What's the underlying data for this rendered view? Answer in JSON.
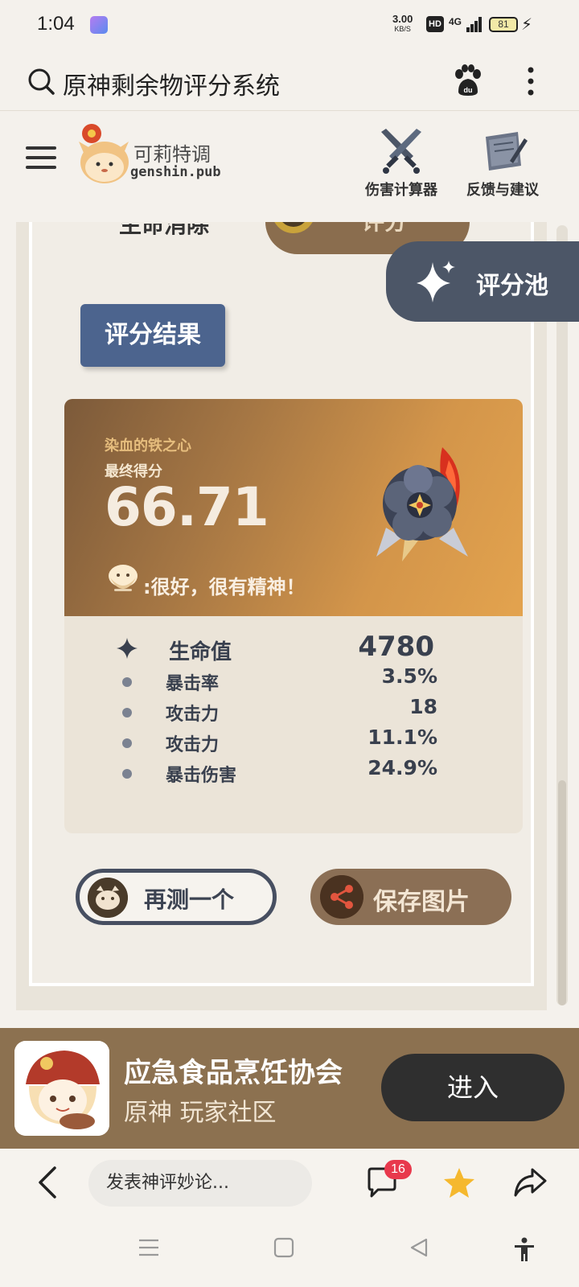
{
  "status_bar": {
    "time": "1:04",
    "net_speed": "3.00",
    "net_unit": "KB/S",
    "hd": "HD",
    "network": "4G",
    "battery": "81"
  },
  "browser": {
    "search_title": "原神剩余物评分系统"
  },
  "site": {
    "brand_name": "可莉特调",
    "brand_domain": "genshin.pub",
    "nav": [
      {
        "label": "伤害计算器",
        "icon": "crossed-swords-icon"
      },
      {
        "label": "反馈与建议",
        "icon": "feedback-note-icon"
      }
    ]
  },
  "partial_row": {
    "label": "生命消除",
    "button_label": "评分"
  },
  "pool_button": {
    "label": "评分池",
    "icon": "sparkle-icon"
  },
  "result_tag": "评分结果",
  "result": {
    "artifact_name": "染血的铁之心",
    "score_label": "最终得分",
    "score": "66.71",
    "comment": ":很好，很有精神！",
    "main_stat": {
      "name": "生命值",
      "value": "4780"
    },
    "sub_stats": [
      {
        "name": "暴击率",
        "value": "3.5%"
      },
      {
        "name": "攻击力",
        "value": "18"
      },
      {
        "name": "攻击力",
        "value": "11.1%"
      },
      {
        "name": "暴击伤害",
        "value": "24.9%"
      }
    ]
  },
  "actions": {
    "retest_label": "再测一个",
    "save_label": "保存图片"
  },
  "banner": {
    "title": "应急食品烹饪协会",
    "subtitle": "原神 玩家社区",
    "enter_label": "进入"
  },
  "toolbar": {
    "comment_placeholder": "发表神评妙论...",
    "comment_count": "16"
  },
  "colors": {
    "accent_slate": "#4c5667",
    "accent_blue": "#4c648e",
    "accent_brown": "#8c7150",
    "badge_red": "#e8394c",
    "star_yellow": "#f5b82e"
  }
}
